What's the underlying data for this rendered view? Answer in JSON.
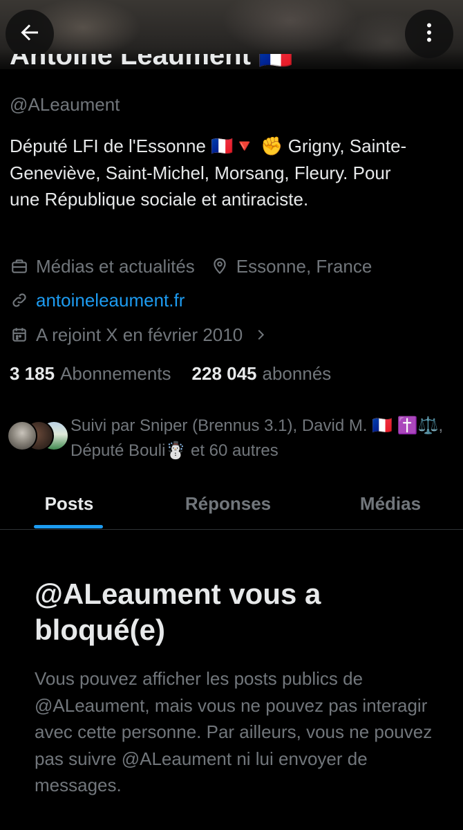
{
  "profile": {
    "name": "Antoine Léaument 🇫🇷",
    "handle": "@ALeaument",
    "bio": "Député LFI de l'Essonne 🇫🇷🔻 ✊ Grigny, Sainte-Geneviève, Saint-Michel, Morsang, Fleury. Pour une République sociale et antiraciste.",
    "category": "Médias et actualités",
    "location": "Essonne, France",
    "website": "antoineleaument.fr",
    "joined": "A rejoint X en février 2010",
    "following_count": "3 185",
    "following_label": "Abonnements",
    "followers_count": "228 045",
    "followers_label": "abonnés",
    "followed_by": "Suivi par Sniper (Brennus 3.1), David M. 🇫🇷 ✝️⚖️, Député Bouli☃️ et 60 autres"
  },
  "tabs": [
    {
      "label": "Posts",
      "active": true
    },
    {
      "label": "Réponses",
      "active": false
    },
    {
      "label": "Médias",
      "active": false
    }
  ],
  "blocked": {
    "title": "@ALeaument vous a bloqué(e)",
    "description": "Vous pouvez afficher les posts publics de @ALeaument, mais vous ne pouvez pas interagir avec cette personne. Par ailleurs, vous ne pouvez pas suivre @ALeaument ni lui envoyer de messages."
  },
  "icons": {
    "back": "arrow-left-icon",
    "more": "more-vertical-icon",
    "category": "briefcase-icon",
    "location": "location-pin-icon",
    "website": "link-icon",
    "joined": "calendar-icon",
    "joined_more": "chevron-right-icon"
  },
  "colors": {
    "accent": "#1d9bf0",
    "text": "#e7e9ea",
    "muted": "#71767b",
    "background": "#000000"
  }
}
